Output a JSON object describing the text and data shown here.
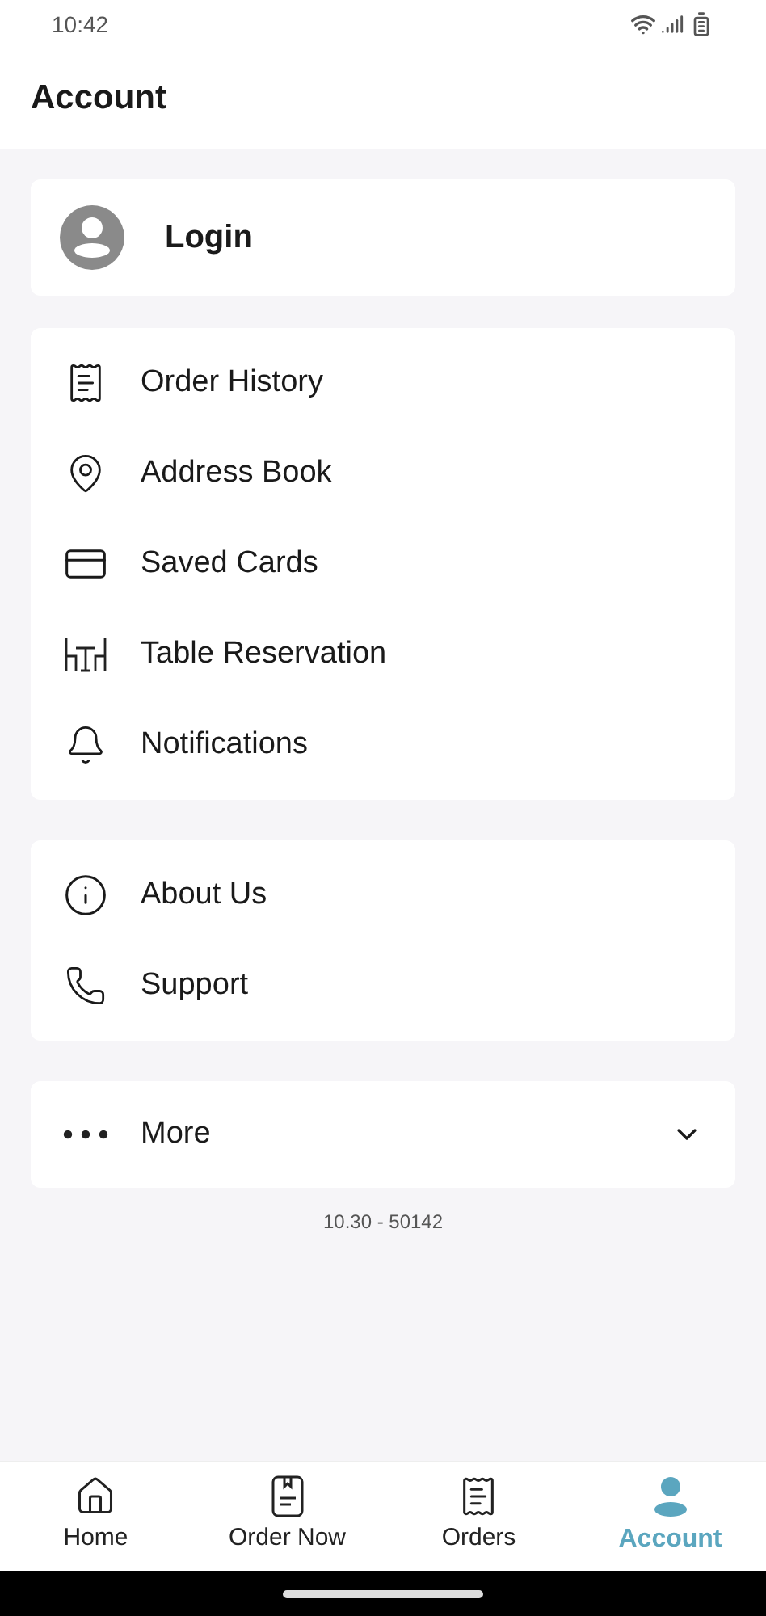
{
  "status_bar": {
    "time": "10:42"
  },
  "header": {
    "title": "Account"
  },
  "login": {
    "label": "Login"
  },
  "menu_groups": [
    {
      "items": [
        "Order History",
        "Address Book",
        "Saved Cards",
        "Table Reservation",
        "Notifications"
      ]
    },
    {
      "items": [
        "About Us",
        "Support"
      ]
    }
  ],
  "more": {
    "label": "More",
    "expanded": false
  },
  "version": "10.30 - 50142",
  "bottom_nav": [
    {
      "label": "Home",
      "selected": false
    },
    {
      "label": "Order Now",
      "selected": false
    },
    {
      "label": "Orders",
      "selected": false
    },
    {
      "label": "Account",
      "selected": true
    }
  ]
}
